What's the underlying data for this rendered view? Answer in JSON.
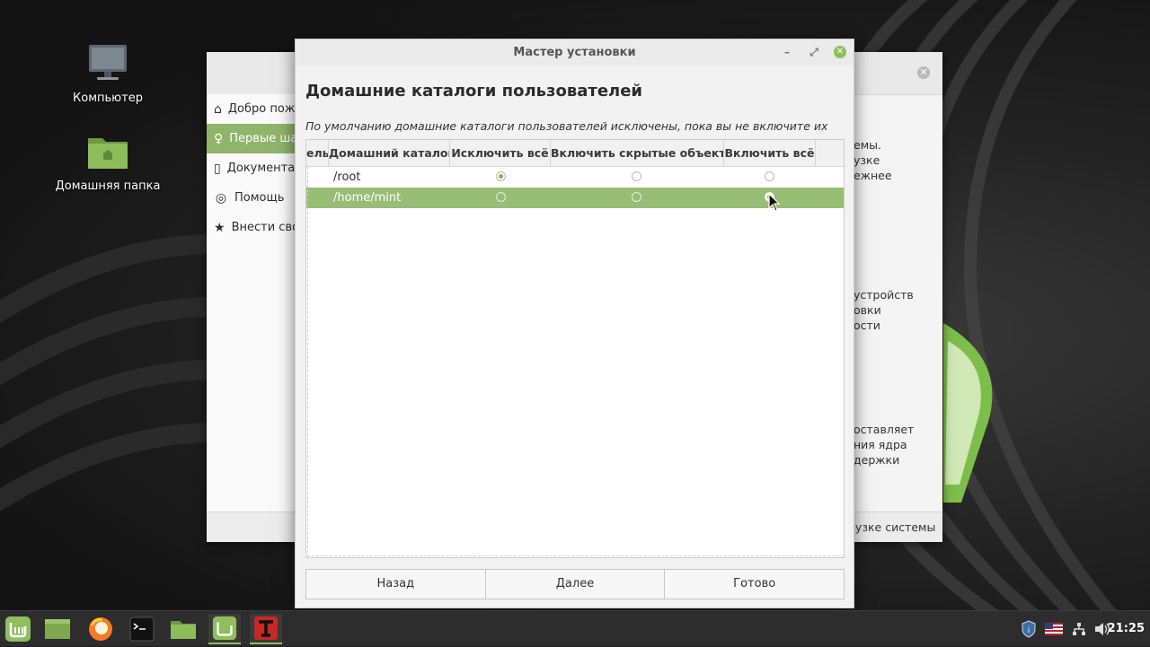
{
  "desktop": {
    "icons": [
      {
        "label": "Компьютер"
      },
      {
        "label": "Домашняя папка"
      }
    ]
  },
  "background_window": {
    "sidebar": [
      {
        "label": "Добро пожаловать",
        "icon": "home-icon"
      },
      {
        "label": "Первые шаги",
        "icon": "bulb-icon"
      },
      {
        "label": "Документация",
        "icon": "book-icon"
      },
      {
        "label": "Помощь",
        "icon": "lifebuoy-icon"
      },
      {
        "label": "Внести свой вклад",
        "icon": "star-icon"
      }
    ],
    "right_text": [
      "емы.",
      "узке",
      "ежнее",
      "устройств",
      "овки",
      "ости",
      "оставляет",
      "ния ядра",
      "держки"
    ],
    "bottom_text": "рузке системы"
  },
  "dialog": {
    "title": "Мастер установки",
    "heading": "Домашние каталоги пользователей",
    "subtitle": "По умолчанию домашние каталоги пользователей исключены, пока вы не включите их",
    "columns": [
      "ель",
      "Домашний каталог",
      "Исключить всё",
      "Включить скрытые объекты",
      "Включить всё"
    ],
    "rows": [
      {
        "path": "/root",
        "selected_option": 0
      },
      {
        "path": "/home/mint",
        "selected_option": 2
      }
    ],
    "buttons": {
      "back": "Назад",
      "next": "Далее",
      "finish": "Готово"
    }
  },
  "taskbar": {
    "clock": "21:25"
  },
  "colors": {
    "accent": "#8fbe5e",
    "selection": "#98bd74"
  }
}
